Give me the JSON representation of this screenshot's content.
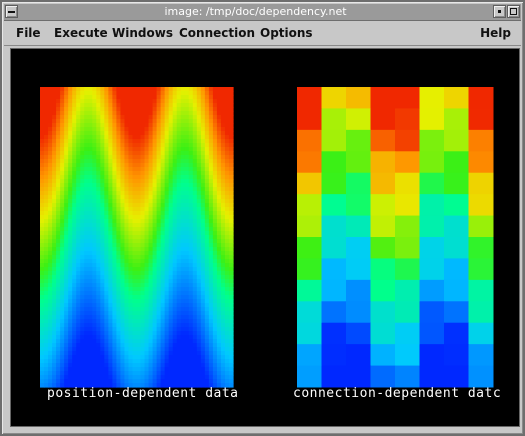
{
  "window": {
    "title": "image: /tmp/doc/dependency.net"
  },
  "menubar": {
    "file": "File",
    "execute": "Execute",
    "windows": "Windows",
    "connection": "Connection",
    "options": "Options",
    "help": "Help"
  },
  "plots": {
    "left": {
      "caption": "position-dependent data",
      "rendering": "smooth gradient field"
    },
    "right": {
      "caption": "connection-dependent datc",
      "rendering": "8x14 cell grid"
    }
  },
  "colors": {
    "background": "#000000",
    "caption": "#ffffff",
    "titlebar": "#9a9a9a",
    "chrome": "#c8c8c8"
  }
}
